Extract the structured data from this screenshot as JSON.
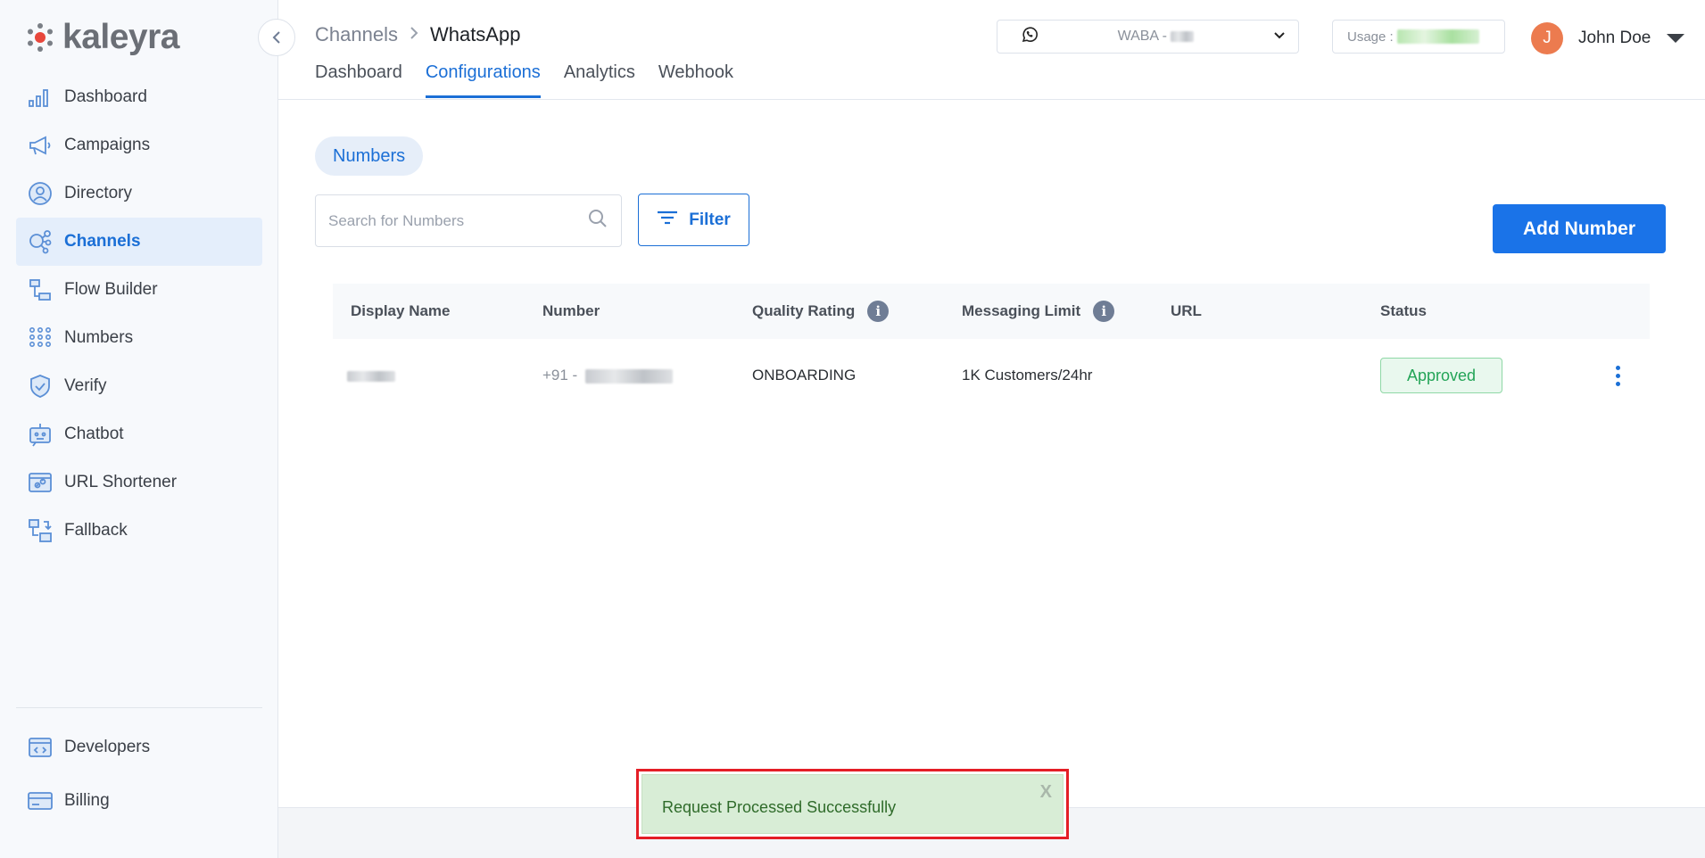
{
  "brand": {
    "name": "kaleyra"
  },
  "sidebar": {
    "items": [
      {
        "label": "Dashboard",
        "icon": "bar-chart-icon"
      },
      {
        "label": "Campaigns",
        "icon": "megaphone-icon"
      },
      {
        "label": "Directory",
        "icon": "user-circle-icon"
      },
      {
        "label": "Channels",
        "icon": "channels-icon",
        "active": true
      },
      {
        "label": "Flow Builder",
        "icon": "flow-icon"
      },
      {
        "label": "Numbers",
        "icon": "dialpad-icon"
      },
      {
        "label": "Verify",
        "icon": "shield-check-icon"
      },
      {
        "label": "Chatbot",
        "icon": "robot-icon"
      },
      {
        "label": "URL Shortener",
        "icon": "link-icon"
      },
      {
        "label": "Fallback",
        "icon": "fallback-icon"
      }
    ],
    "bottom_items": [
      {
        "label": "Developers",
        "icon": "code-icon"
      },
      {
        "label": "Billing",
        "icon": "credit-card-icon"
      }
    ]
  },
  "header": {
    "breadcrumb": {
      "parent": "Channels",
      "current": "WhatsApp"
    },
    "tabs": [
      {
        "label": "Dashboard"
      },
      {
        "label": "Configurations",
        "active": true
      },
      {
        "label": "Analytics"
      },
      {
        "label": "Webhook"
      }
    ],
    "waba_prefix": "WABA -",
    "usage_label": "Usage :",
    "user": {
      "initial": "J",
      "name": "John Doe"
    }
  },
  "main": {
    "section_pill": "Numbers",
    "search_placeholder": "Search for Numbers",
    "filter_label": "Filter",
    "add_button": "Add Number",
    "table": {
      "headers": [
        "Display Name",
        "Number",
        "Quality Rating",
        "Messaging Limit",
        "URL",
        "Status"
      ],
      "rows": [
        {
          "number_prefix": "+91 -",
          "quality": "ONBOARDING",
          "limit": "1K Customers/24hr",
          "url": "",
          "status": "Approved"
        }
      ]
    }
  },
  "toast": {
    "message": "Request Processed Successfully",
    "close": "X"
  },
  "colors": {
    "accent": "#1b6fd6",
    "primary_button": "#1a73e8",
    "success": "#23a457",
    "toast_bg": "#d8edd6",
    "highlight": "#e41e26",
    "avatar": "#ec7b4f"
  }
}
